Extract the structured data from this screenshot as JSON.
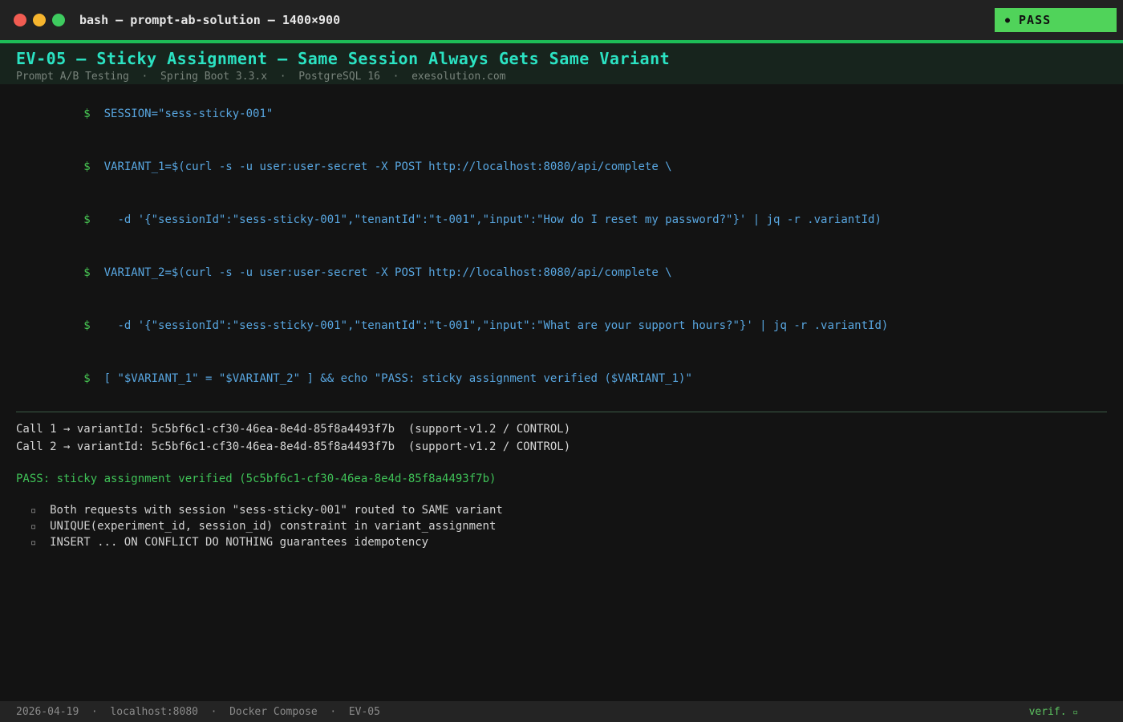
{
  "window": {
    "title": "bash — prompt-ab-solution — 1400×900",
    "badge": {
      "dot": "●",
      "label": "PASS"
    }
  },
  "header": {
    "title": "EV-05 — Sticky Assignment — Same Session Always Gets Same Variant",
    "subtitle": "Prompt A/B Testing  ·  Spring Boot 3.3.x  ·  PostgreSQL 16  ·  exesolution.com"
  },
  "terminal": {
    "prompt": "$",
    "commands": [
      "  SESSION=\"sess-sticky-001\"",
      "  VARIANT_1=$(curl -s -u user:user-secret -X POST http://localhost:8080/api/complete \\",
      "    -d '{\"sessionId\":\"sess-sticky-001\",\"tenantId\":\"t-001\",\"input\":\"How do I reset my password?\"}' | jq -r .variantId)",
      "  VARIANT_2=$(curl -s -u user:user-secret -X POST http://localhost:8080/api/complete \\",
      "    -d '{\"sessionId\":\"sess-sticky-001\",\"tenantId\":\"t-001\",\"input\":\"What are your support hours?\"}' | jq -r .variantId)",
      "  [ \"$VARIANT_1\" = \"$VARIANT_2\" ] && echo \"PASS: sticky assignment verified ($VARIANT_1)\""
    ],
    "outputs": [
      "Call 1 → variantId: 5c5bf6c1-cf30-46ea-8e4d-85f8a4493f7b  (support-v1.2 / CONTROL)",
      "Call 2 → variantId: 5c5bf6c1-cf30-46ea-8e4d-85f8a4493f7b  (support-v1.2 / CONTROL)"
    ],
    "pass_line": "PASS: sticky assignment verified (5c5bf6c1-cf30-46ea-8e4d-85f8a4493f7b)",
    "bullet_glyph": "▫",
    "bullets": [
      "Both requests with session \"sess-sticky-001\" routed to SAME variant",
      "UNIQUE(experiment_id, session_id) constraint in variant_assignment",
      "INSERT ... ON CONFLICT DO NOTHING guarantees idempotency"
    ]
  },
  "footer": {
    "left": "2026-04-19  ·  localhost:8080  ·  Docker Compose  ·  EV-05",
    "right": "verif.",
    "cursor": "▫"
  },
  "colors": {
    "accent_green": "#1dbd57",
    "badge_green": "#50d35a",
    "title_cyan": "#2be2c2",
    "command_blue": "#58a6e0",
    "prompt_green": "#47c653",
    "pass_green": "#3fc257"
  }
}
